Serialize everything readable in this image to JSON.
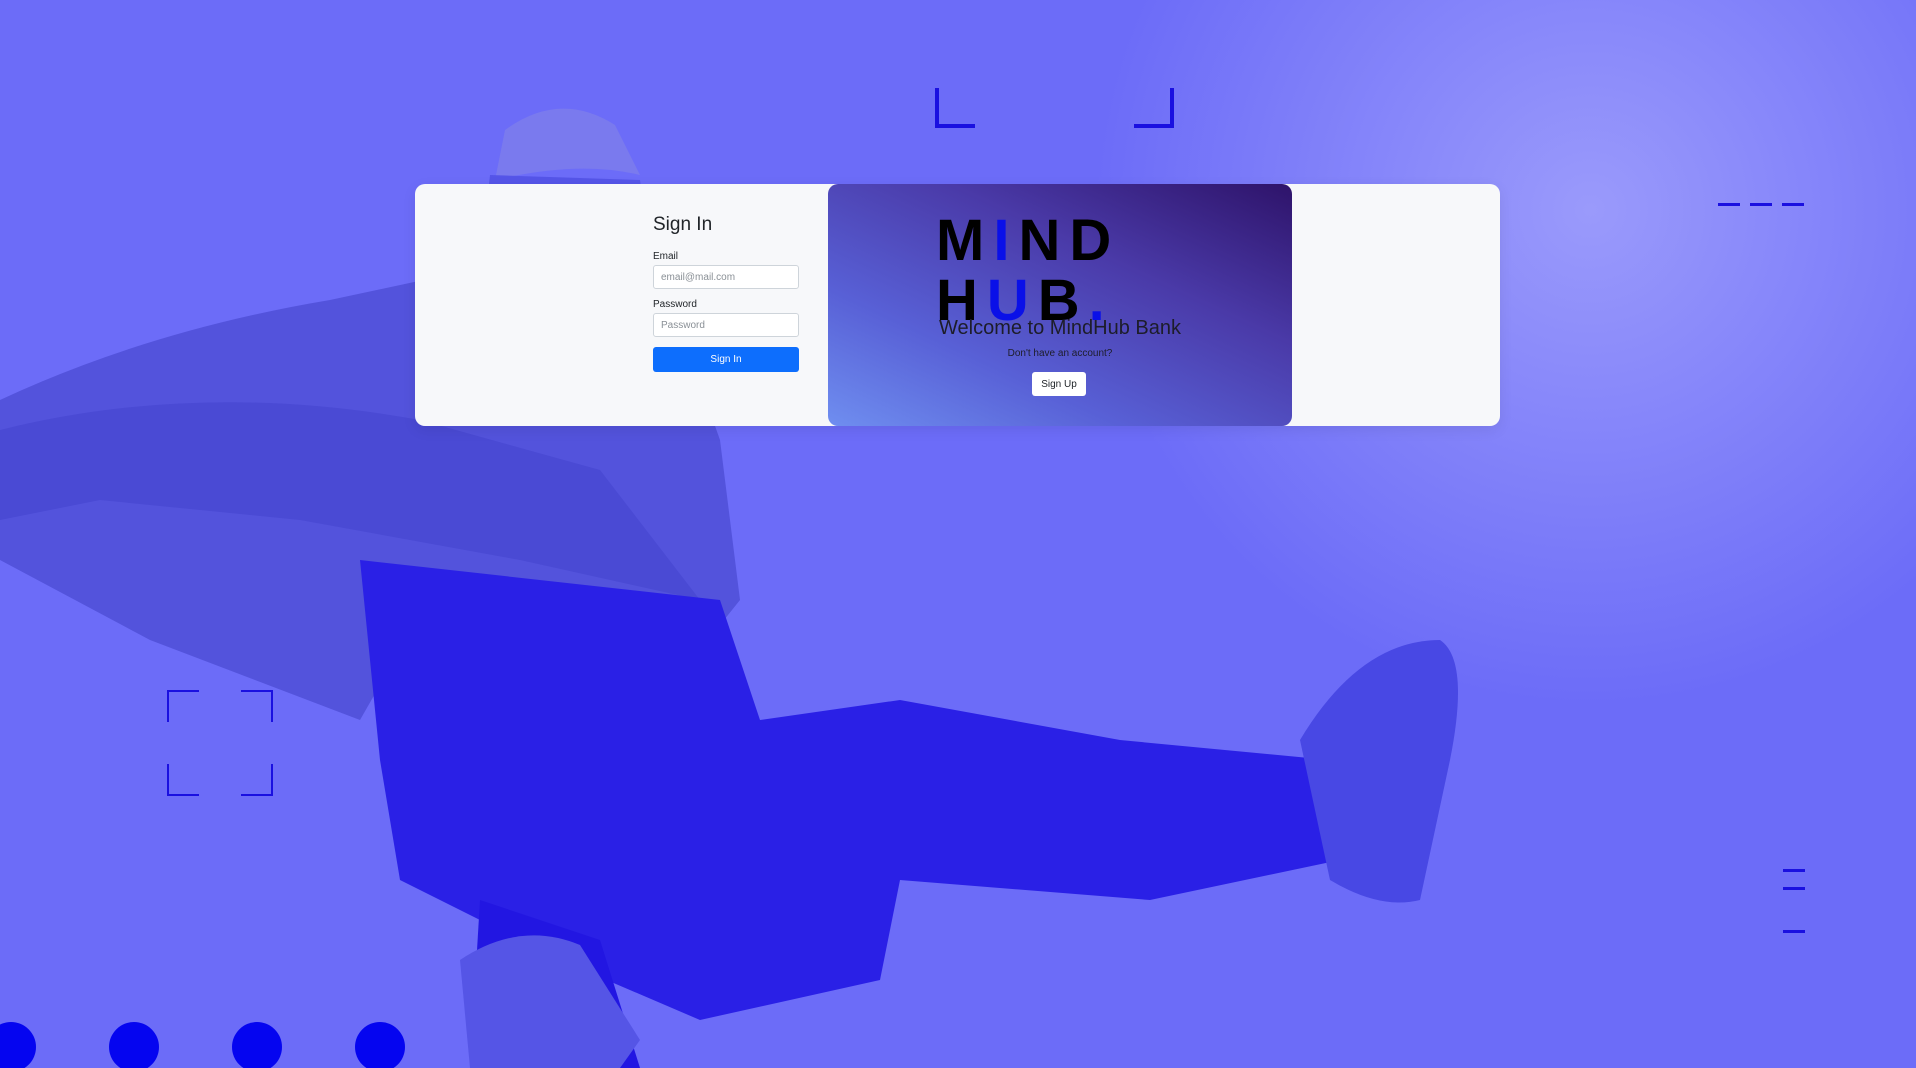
{
  "signin": {
    "title": "Sign In",
    "email_label": "Email",
    "email_placeholder": "email@mail.com",
    "email_value": "",
    "password_label": "Password",
    "password_placeholder": "Password",
    "password_value": "",
    "submit_label": "Sign In"
  },
  "promo": {
    "logo_line1": "MIND",
    "logo_line2": "HUB.",
    "welcome": "Welcome to MindHub Bank",
    "no_account": "Don't have an account?",
    "signup_label": "Sign Up"
  },
  "colors": {
    "background": "#6c6cf8",
    "accent": "#0505f0",
    "primary_button": "#0d6efd",
    "card": "#f7f8fa"
  },
  "icons": [
    "corner-bracket-icon",
    "dash-icon",
    "dot-icon"
  ]
}
